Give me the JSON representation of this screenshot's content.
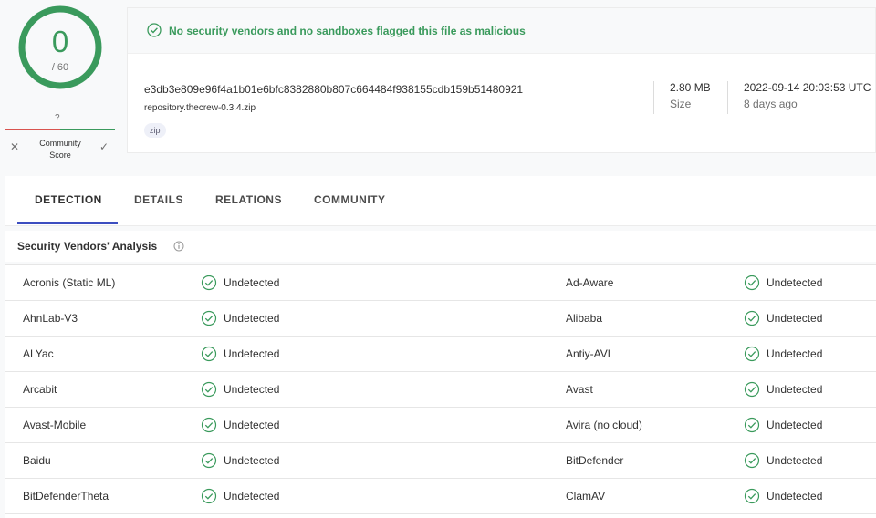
{
  "score": {
    "detections": "0",
    "total": "/ 60",
    "color": "#3a9a5c"
  },
  "community": {
    "value": "?",
    "label_line1": "Community",
    "label_line2": "Score"
  },
  "banner": {
    "text": "No security vendors and no sandboxes flagged this file as malicious",
    "icon": "check-circle-icon"
  },
  "file": {
    "hash": "e3db3e809e96f4a1b01e6bfc8382880b807c664484f938155cdb159b51480921",
    "name": "repository.thecrew-0.3.4.zip",
    "tag": "zip",
    "size_value": "2.80 MB",
    "size_label": "Size",
    "date_value": "2022-09-14 20:03:53 UTC",
    "date_label": "8 days ago"
  },
  "tabs": [
    {
      "label": "DETECTION",
      "active": true
    },
    {
      "label": "DETAILS",
      "active": false
    },
    {
      "label": "RELATIONS",
      "active": false
    },
    {
      "label": "COMMUNITY",
      "active": false
    }
  ],
  "section": {
    "title": "Security Vendors' Analysis",
    "icon": "info-icon"
  },
  "vendors": [
    {
      "left": "Acronis (Static ML)",
      "left_status": "Undetected",
      "right": "Ad-Aware",
      "right_status": "Undetected"
    },
    {
      "left": "AhnLab-V3",
      "left_status": "Undetected",
      "right": "Alibaba",
      "right_status": "Undetected"
    },
    {
      "left": "ALYac",
      "left_status": "Undetected",
      "right": "Antiy-AVL",
      "right_status": "Undetected"
    },
    {
      "left": "Arcabit",
      "left_status": "Undetected",
      "right": "Avast",
      "right_status": "Undetected"
    },
    {
      "left": "Avast-Mobile",
      "left_status": "Undetected",
      "right": "Avira (no cloud)",
      "right_status": "Undetected"
    },
    {
      "left": "Baidu",
      "left_status": "Undetected",
      "right": "BitDefender",
      "right_status": "Undetected"
    },
    {
      "left": "BitDefenderTheta",
      "left_status": "Undetected",
      "right": "ClamAV",
      "right_status": "Undetected"
    }
  ],
  "colors": {
    "clean_green": "#3a9a5c",
    "accent_blue": "#3c4ec0",
    "malicious_red": "#d9534f"
  }
}
